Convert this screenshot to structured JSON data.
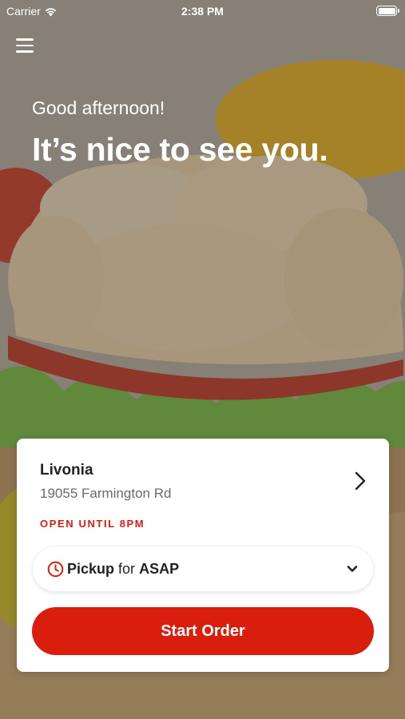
{
  "status_bar": {
    "carrier": "Carrier",
    "time": "2:38 PM"
  },
  "hero": {
    "greeting": "Good afternoon!",
    "headline": "It’s nice to see you."
  },
  "store": {
    "name": "Livonia",
    "address": "19055 Farmington Rd",
    "open_status": "OPEN UNTIL 8PM"
  },
  "order_mode": {
    "mode": "Pickup",
    "connector": "for",
    "time": "ASAP"
  },
  "actions": {
    "start_order_label": "Start Order"
  },
  "colors": {
    "accent": "#d91e0e",
    "open_status": "#d81e12"
  },
  "icons": {
    "menu": "hamburger-menu-icon",
    "wifi": "wifi-icon",
    "battery": "battery-icon",
    "store_chevron": "chevron-right-icon",
    "clock": "clock-icon",
    "dropdown": "chevron-down-icon"
  }
}
